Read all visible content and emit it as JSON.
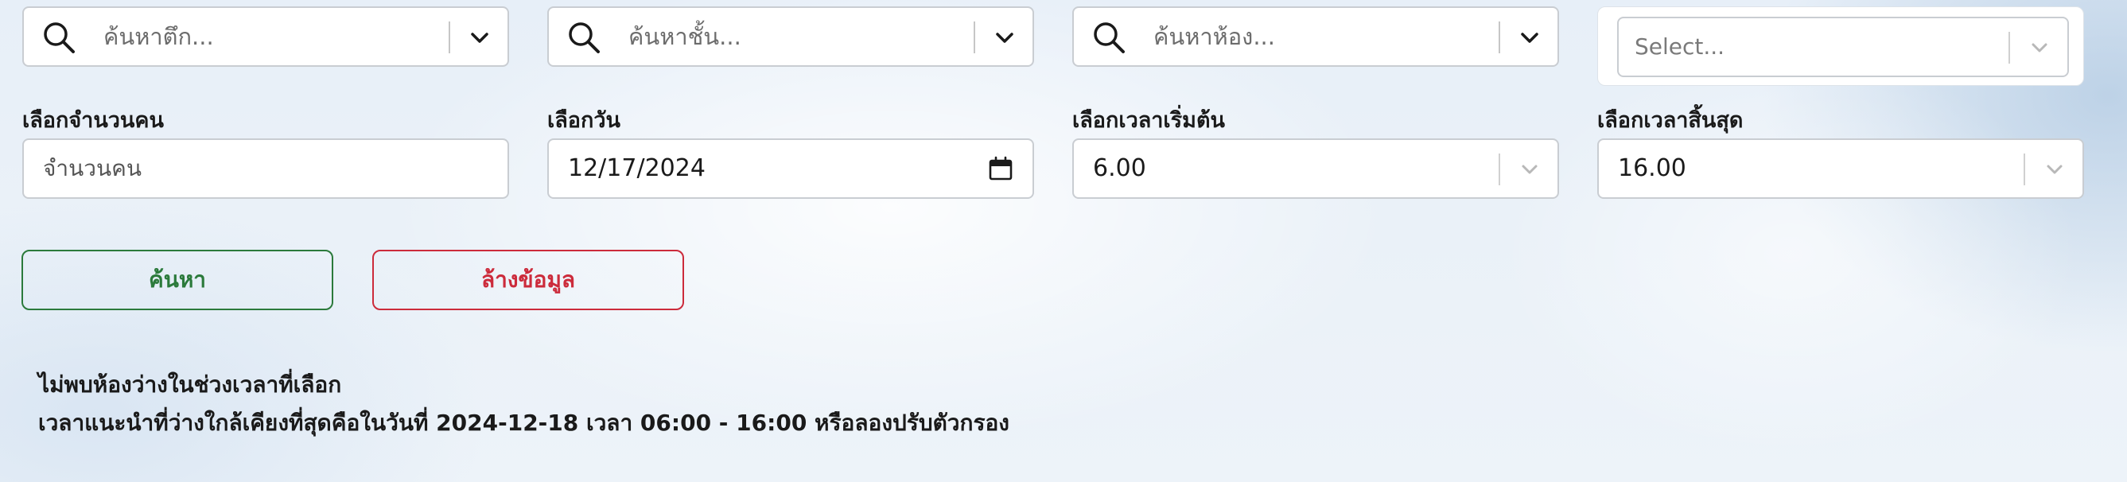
{
  "filters": {
    "building": {
      "placeholder": "ค้นหาตึก..."
    },
    "floor": {
      "placeholder": "ค้นหาชั้น..."
    },
    "room": {
      "placeholder": "ค้นหาห้อง..."
    },
    "extra": {
      "placeholder": "Select..."
    }
  },
  "labels": {
    "people": "เลือกจำนวนคน",
    "date": "เลือกวัน",
    "start_time": "เลือกเวลาเริ่มต้น",
    "end_time": "เลือกเวลาสิ้นสุด"
  },
  "fields": {
    "people_placeholder": "จำนวนคน",
    "date_value": "12/17/2024",
    "start_time_value": "6.00",
    "end_time_value": "16.00"
  },
  "buttons": {
    "search": "ค้นหา",
    "clear": "ล้างข้อมูล"
  },
  "messages": {
    "not_found": "ไม่พบห้องว่างในช่วงเวลาที่เลือก",
    "suggestion": "เวลาแนะนำที่ว่างใกล้เคียงที่สุดคือในวันที่ 2024-12-18 เวลา 06:00 - 16:00 หรือลองปรับตัวกรอง"
  },
  "icons": {
    "search": "search-icon",
    "dropdown": "chevron-down-icon",
    "calendar": "calendar-icon"
  },
  "colors": {
    "search_button": "#2b7a3b",
    "clear_button": "#cc2b3b"
  }
}
